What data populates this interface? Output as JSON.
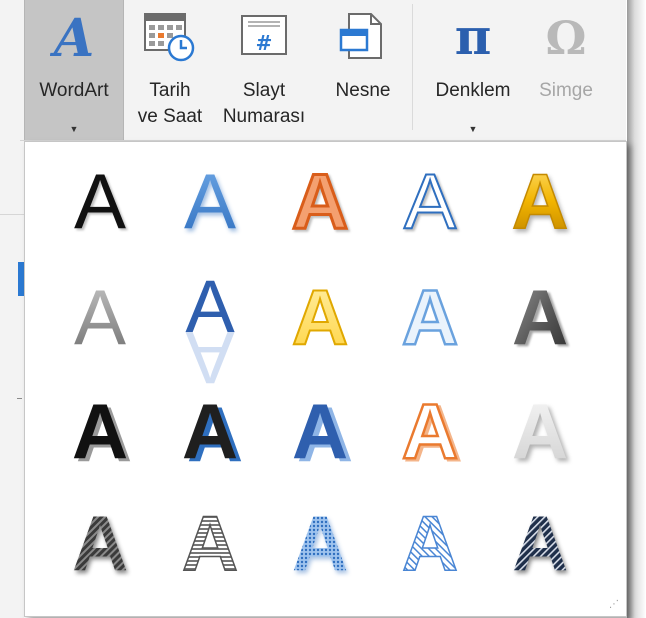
{
  "ribbon": {
    "wordart_label": "WordArt",
    "tarih_line1": "Tarih",
    "tarih_line2": "ve Saat",
    "slayt_line1": "Slayt",
    "slayt_line2": "Numarası",
    "nesne_label": "Nesne",
    "denklem_label": "Denklem",
    "simge_label": "Simge",
    "dropdown_arrow": "▼",
    "slide_number_glyph": "#",
    "pi_glyph": "π",
    "omega_glyph": "Ω"
  },
  "gallery": {
    "style_letter": "A",
    "grip": "⋰"
  },
  "colors": {
    "wordart_icon": "#3a73c2",
    "selected_bg": "#c5c5c5",
    "accent_blue": "#2b79d2",
    "orange": "#ea7a2f",
    "gold": "#f2b400",
    "disabled": "#a6a6a6"
  }
}
